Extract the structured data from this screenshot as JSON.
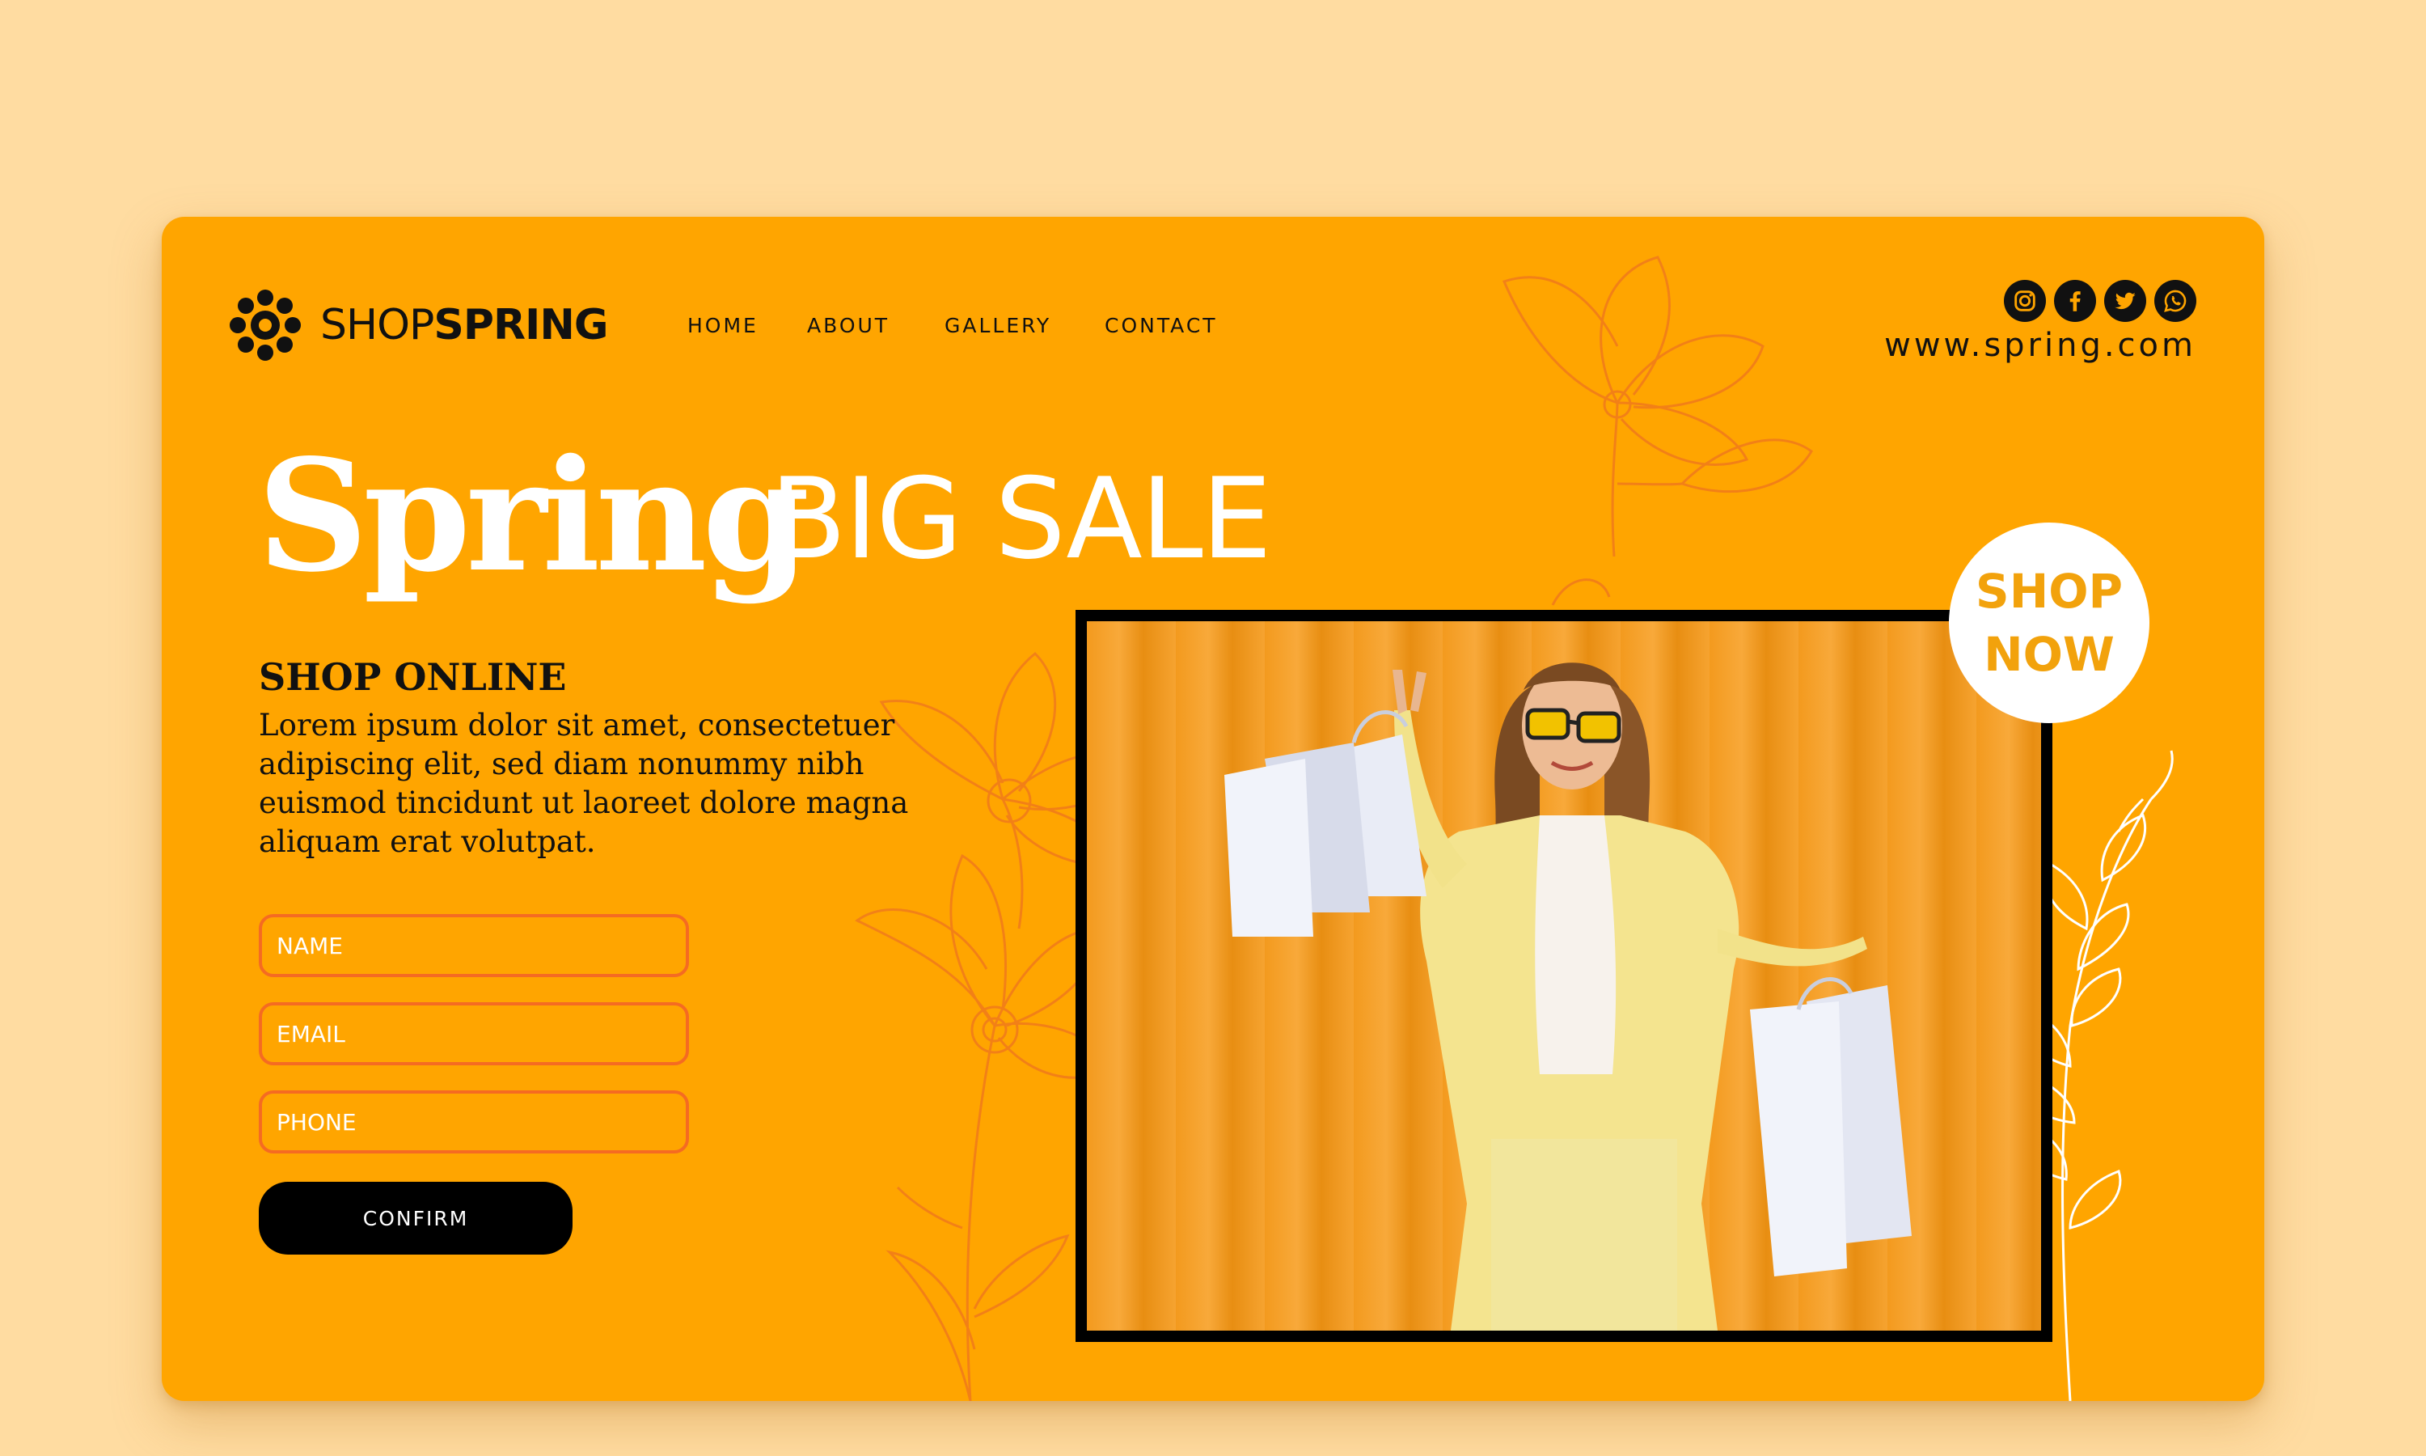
{
  "brand": {
    "name_light": "SHOP",
    "name_bold": "SPRING",
    "logo_icon": "flower-logo-icon"
  },
  "nav": {
    "items": [
      "HOME",
      "ABOUT",
      "GALLERY",
      "CONTACT"
    ]
  },
  "socials": {
    "icons": [
      "instagram-icon",
      "facebook-icon",
      "twitter-icon",
      "whatsapp-icon"
    ]
  },
  "site_url": "www.spring.com",
  "hero": {
    "word1": "Spring",
    "word2": "BIG SALE"
  },
  "promo": {
    "heading": "SHOP ONLINE",
    "body": "Lorem ipsum dolor sit amet, consectetuer adipiscing elit, sed diam nonummy nibh euismod tincidunt ut laoreet dolore magna aliquam erat volutpat."
  },
  "form": {
    "name_placeholder": "NAME",
    "email_placeholder": "EMAIL",
    "phone_placeholder": "PHONE",
    "confirm_label": "CONFIRM"
  },
  "cta": {
    "line1": "SHOP",
    "line2": "NOW"
  },
  "colors": {
    "background": "#FFDCA1",
    "card": "#FFA500",
    "accent_line": "#F56B22",
    "cta_text": "#F2A20C"
  }
}
